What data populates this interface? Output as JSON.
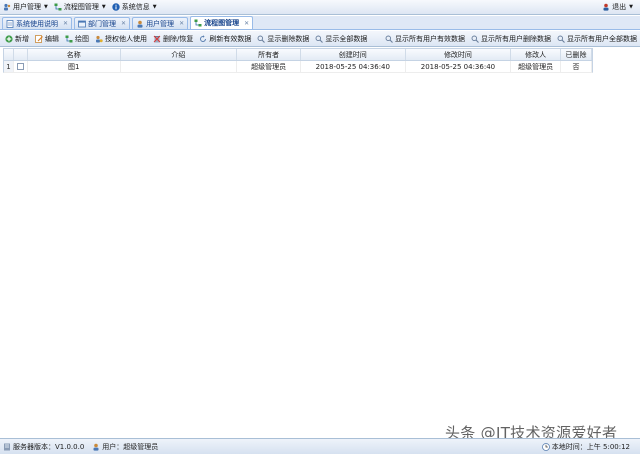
{
  "menubar": {
    "items": [
      {
        "label": "用户管理",
        "icon": "users-icon"
      },
      {
        "label": "流程图管理",
        "icon": "flowchart-icon"
      },
      {
        "label": "系统信息",
        "icon": "info-icon"
      }
    ],
    "exit_label": "退出"
  },
  "tabs": [
    {
      "label": "系统使用说明",
      "icon": "document-icon"
    },
    {
      "label": "部门管理",
      "icon": "department-icon"
    },
    {
      "label": "用户管理",
      "icon": "user-icon"
    },
    {
      "label": "流程图管理",
      "icon": "flowchart-icon"
    }
  ],
  "toolbar": {
    "left": [
      {
        "label": "新增",
        "icon": "add-icon"
      },
      {
        "label": "编辑",
        "icon": "edit-icon"
      },
      {
        "label": "绘图",
        "icon": "draw-icon"
      },
      {
        "label": "授权他人使用",
        "icon": "authorize-icon"
      },
      {
        "label": "删除/恢复",
        "icon": "delete-icon"
      },
      {
        "label": "刷新有效数据",
        "icon": "refresh-icon"
      },
      {
        "label": "显示删除数据",
        "icon": "show-deleted-icon"
      },
      {
        "label": "显示全部数据",
        "icon": "show-all-icon"
      }
    ],
    "right": [
      {
        "label": "显示所有用户有效数据",
        "icon": "search-icon"
      },
      {
        "label": "显示所有用户删除数据",
        "icon": "search-icon"
      },
      {
        "label": "显示所有用户全部数据",
        "icon": "search-icon"
      }
    ]
  },
  "grid": {
    "columns": [
      "名称",
      "介绍",
      "所有者",
      "创建时间",
      "修改时间",
      "修改人",
      "已删除"
    ],
    "rows": [
      {
        "num": "1",
        "name": "图1",
        "intro": "",
        "owner": "超级管理员",
        "created": "2018-05-25 04:36:40",
        "modified": "2018-05-25 04:36:40",
        "modifier": "超级管理员",
        "deleted": "否"
      }
    ]
  },
  "status": {
    "version": "服务器版本：V1.0.0.0",
    "user": "用户：超级管理员",
    "clock": "本地时间：上午 5:00:12"
  },
  "watermark": "头条 @IT技术资源爱好者"
}
